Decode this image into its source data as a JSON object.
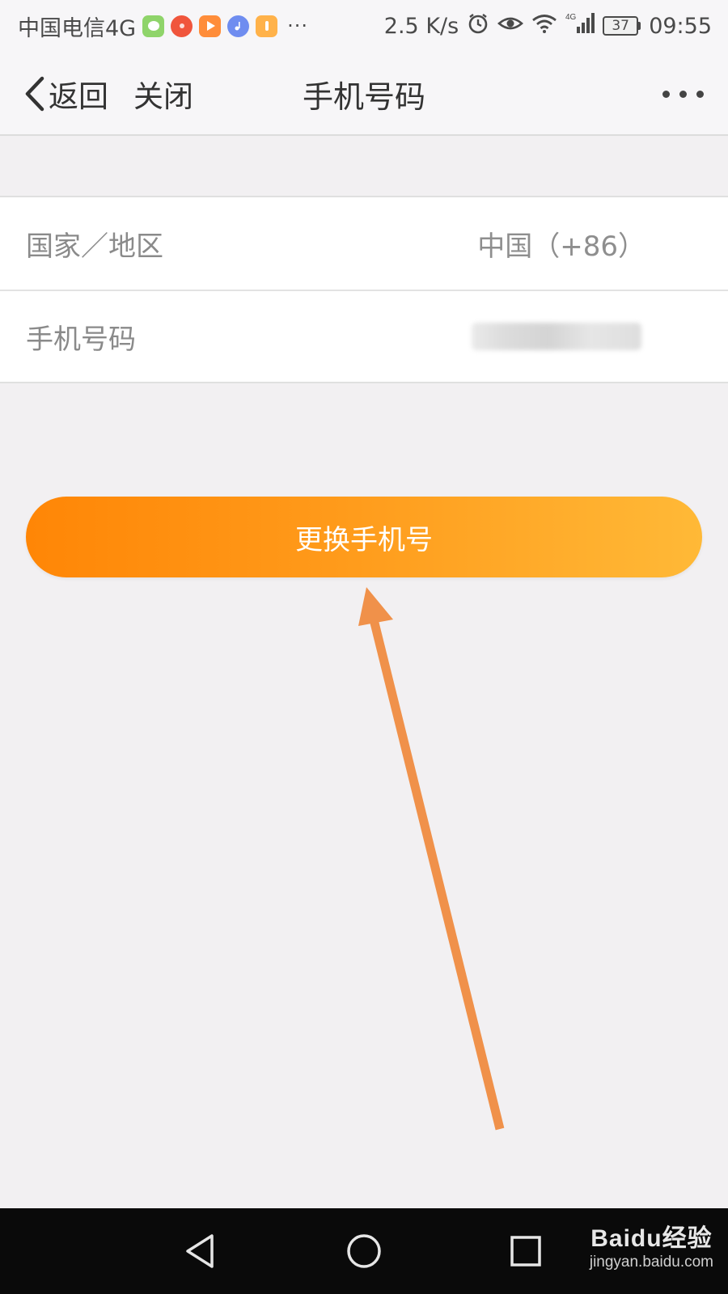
{
  "status_bar": {
    "carrier": "中国电信4G",
    "notification_icons": [
      {
        "name": "wechat-icon",
        "color": "#8fd46a",
        "round": false
      },
      {
        "name": "app-red-icon",
        "color": "#f0553c",
        "round": true
      },
      {
        "name": "video-play-icon",
        "color": "#ff8d3a",
        "round": false
      },
      {
        "name": "music-icon",
        "color": "#6f8df0",
        "round": true
      },
      {
        "name": "app-orange-icon",
        "color": "#ffb24a",
        "round": false
      }
    ],
    "more": "···",
    "network_speed": "2.5 K/s",
    "battery_level": "37",
    "time": "09:55"
  },
  "header": {
    "back_label": "返回",
    "close_label": "关闭",
    "title": "手机号码"
  },
  "form": {
    "rows": [
      {
        "label": "国家／地区",
        "value": "中国（+86）"
      },
      {
        "label": "手机号码",
        "value": ""
      }
    ]
  },
  "actions": {
    "change_phone_label": "更换手机号"
  },
  "watermark": {
    "brand": "Baidu经验",
    "url": "jingyan.baidu.com"
  },
  "colors": {
    "accent_start": "#ff8606",
    "accent_end": "#ffb937",
    "annotation_arrow": "#f0914a"
  }
}
